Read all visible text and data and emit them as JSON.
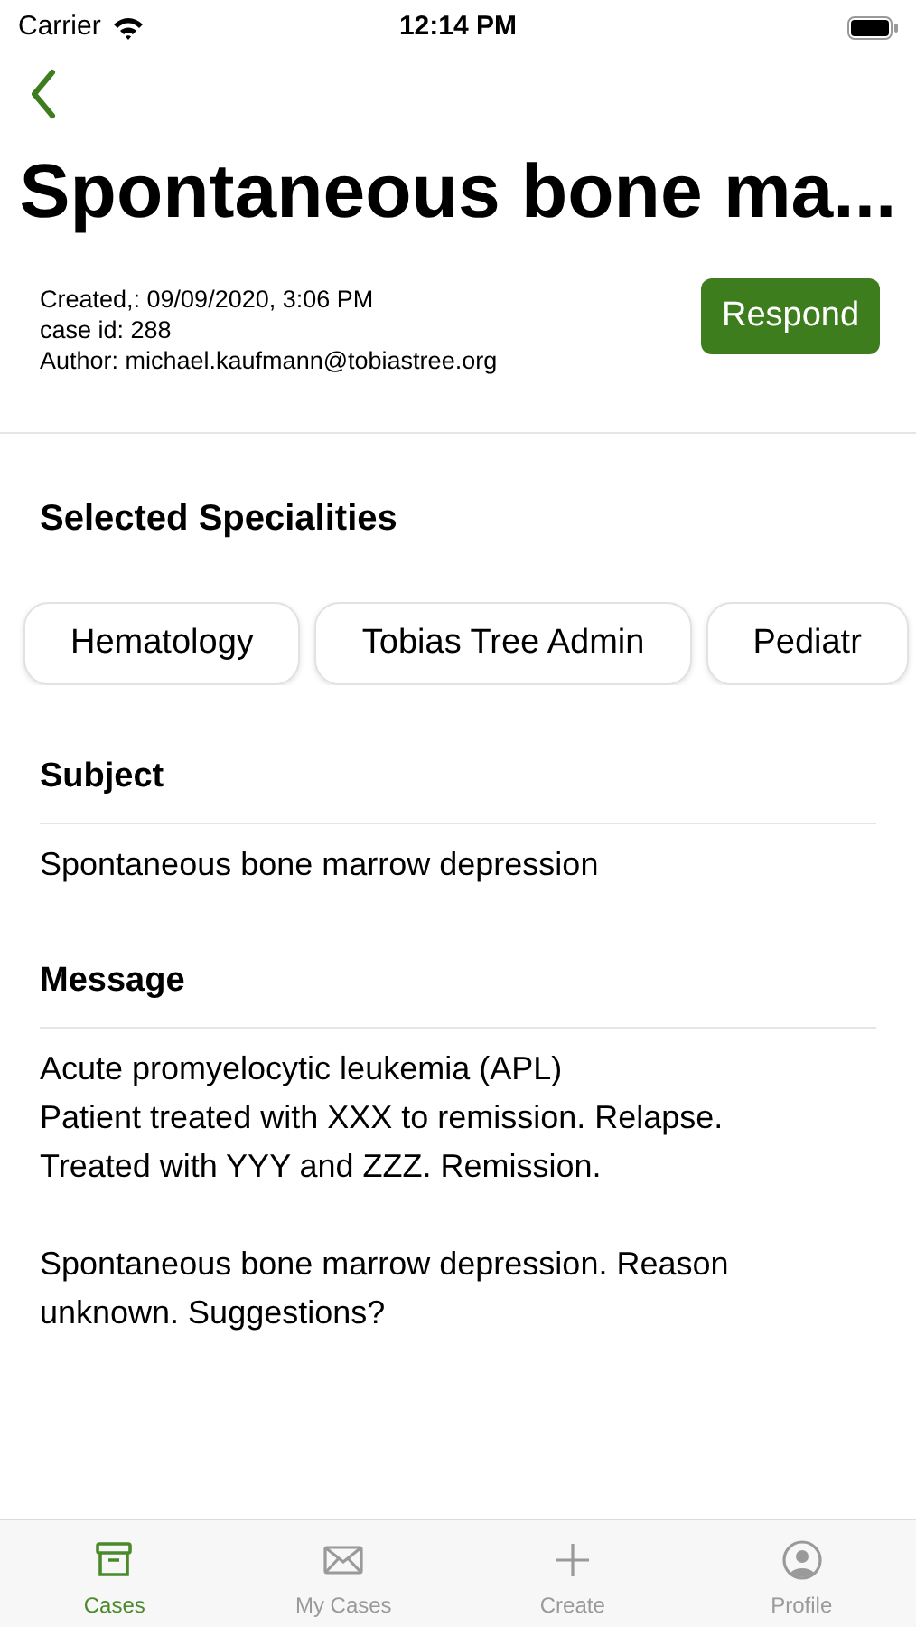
{
  "status_bar": {
    "carrier": "Carrier",
    "time": "12:14 PM"
  },
  "title": "Spontaneous bone ma...",
  "meta": [
    "Created,: 09/09/2020, 3:06 PM",
    "case id: 288",
    "Author: michael.kaufmann@tobiastree.org"
  ],
  "respond_button": "Respond",
  "specialities": {
    "heading": "Selected Specialities",
    "items": [
      "Hematology",
      "Tobias Tree Admin",
      "Pediatr"
    ]
  },
  "subject": {
    "heading": "Subject",
    "text": "Spontaneous bone marrow depression"
  },
  "message": {
    "heading": "Message",
    "text": "Acute promyelocytic leukemia (APL)\nPatient treated with XXX to remission. Relapse.\nTreated with YYY and ZZZ. Remission.\n\nSpontaneous bone marrow depression. Reason unknown. Suggestions?"
  },
  "tabs": [
    {
      "label": "Cases",
      "kind": "box",
      "selected": true
    },
    {
      "label": "My Cases",
      "kind": "mail",
      "selected": false
    },
    {
      "label": "Create",
      "kind": "plus",
      "selected": false
    },
    {
      "label": "Profile",
      "kind": "person",
      "selected": false
    }
  ]
}
